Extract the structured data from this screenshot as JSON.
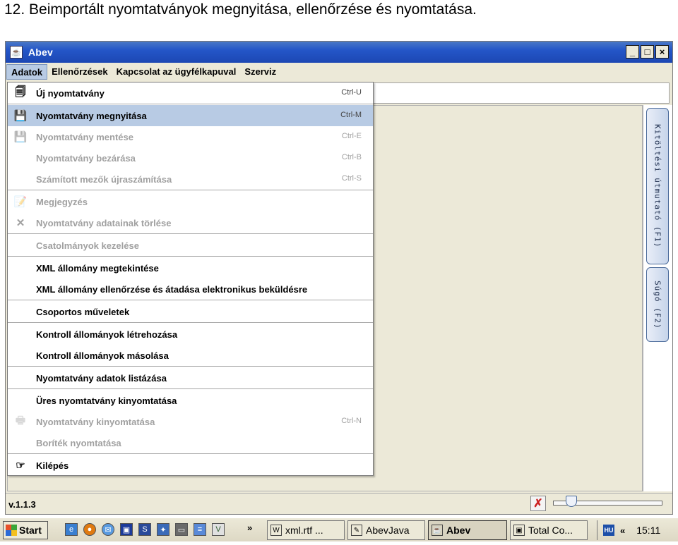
{
  "document": {
    "heading": "12. Beimportált nyomtatványok megnyitása, ellenőrzése és nyomtatása."
  },
  "window": {
    "title": "Abev",
    "icon": "java-cup-icon",
    "buttons": [
      "_",
      "□",
      "×"
    ]
  },
  "menubar": {
    "items": [
      "Adatok",
      "Ellenőrzések",
      "Kapcsolat az ügyfélkapuval",
      "Szerviz"
    ],
    "active": "Adatok"
  },
  "dropdown": {
    "items": [
      {
        "label": "Új nyomtatvány",
        "shortcut": "Ctrl-U",
        "icon": "new-document-icon",
        "enabled": true
      },
      {
        "label": "Nyomtatvány megnyitása",
        "shortcut": "Ctrl-M",
        "icon": "open-form-icon",
        "enabled": true,
        "highlighted": true
      },
      {
        "label": "Nyomtatvány mentése",
        "shortcut": "Ctrl-E",
        "icon": "save-icon",
        "enabled": false
      },
      {
        "label": "Nyomtatvány bezárása",
        "shortcut": "Ctrl-B",
        "enabled": false
      },
      {
        "label": "Számított mezők újraszámítása",
        "shortcut": "Ctrl-S",
        "enabled": false
      },
      {
        "label": "Megjegyzés",
        "icon": "note-icon",
        "enabled": false
      },
      {
        "label": "Nyomtatvány adatainak törlése",
        "icon": "delete-x-icon",
        "enabled": false
      },
      {
        "label": "Csatolmányok kezelése",
        "enabled": false
      },
      {
        "label": "XML állomány megtekintése",
        "enabled": true
      },
      {
        "label": "XML állomány ellenőrzése és átadása elektronikus beküldésre",
        "enabled": true
      },
      {
        "label": "Csoportos műveletek",
        "enabled": true
      },
      {
        "label": "Kontroll állományok létrehozása",
        "enabled": true
      },
      {
        "label": "Kontroll állományok másolása",
        "enabled": true
      },
      {
        "label": "Nyomtatvány adatok listázása",
        "enabled": true
      },
      {
        "label": "Üres nyomtatvány kinyomtatása",
        "enabled": true
      },
      {
        "label": "Nyomtatvány kinyomtatása",
        "shortcut": "Ctrl-N",
        "icon": "printer-icon",
        "enabled": false
      },
      {
        "label": "Boríték nyomtatása",
        "enabled": false
      },
      {
        "label": "Kilépés",
        "icon": "exit-hand-icon",
        "enabled": true
      }
    ]
  },
  "side_tabs": {
    "help_guide": "Kitöltési útmutató (F1)",
    "help": "Súgó (F2)"
  },
  "statusbar": {
    "version": "v.1.1.3",
    "slider_value": 0.17
  },
  "taskbar": {
    "start_label": "Start",
    "quicklaunch_more": "»",
    "tasks": [
      {
        "label": "xml.rtf ...",
        "icon": "word-doc-icon",
        "active": false
      },
      {
        "label": "AbevJava",
        "icon": "edit-icon",
        "active": false
      },
      {
        "label": "Abev",
        "icon": "java-cup-icon",
        "active": true
      },
      {
        "label": "Total Co...",
        "icon": "save-disk-icon",
        "active": false
      }
    ],
    "tray_lang": "HU",
    "tray_collapse": "«",
    "clock": "15:11"
  }
}
